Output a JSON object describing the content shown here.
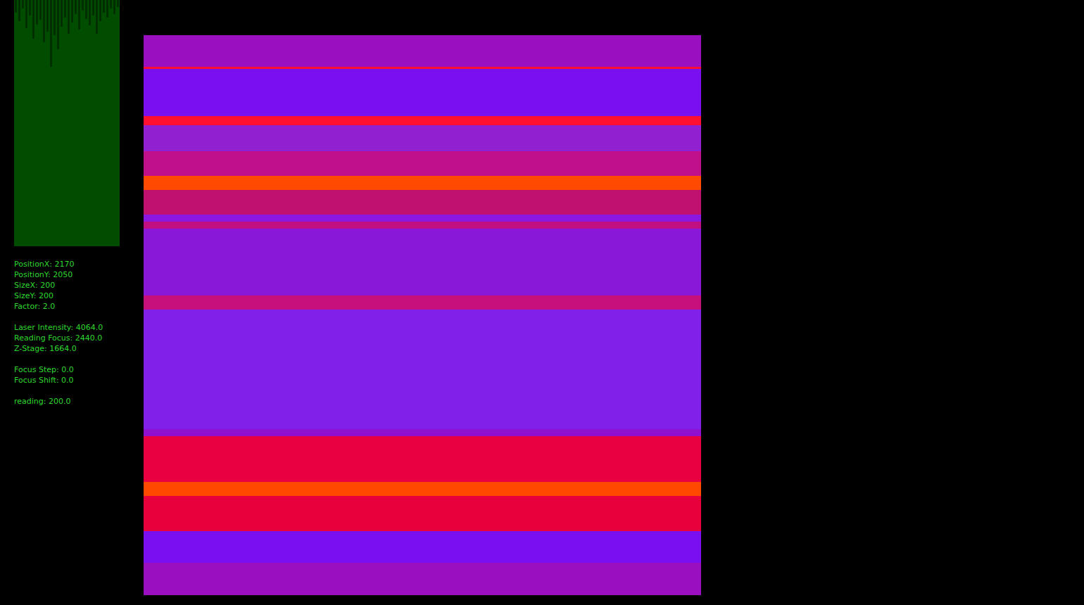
{
  "histogram": {
    "values": [
      18,
      30,
      12,
      40,
      22,
      55,
      35,
      28,
      60,
      45,
      95,
      50,
      70,
      38,
      25,
      48,
      32,
      20,
      42,
      15,
      27,
      36,
      22,
      48,
      30,
      18,
      25,
      12,
      20,
      10
    ]
  },
  "readouts": [
    [
      "PositionX: 2170",
      "PositionY: 2050",
      "SizeX: 200",
      "SizeY: 200",
      "Factor: 2.0"
    ],
    [
      "Laser Intensity: 4064.0",
      "Reading Focus: 2440.0",
      "Z-Stage: 1664.0"
    ],
    [
      "Focus Step: 0.0",
      "Focus Shift: 0.0"
    ],
    [
      "reading: 200.0"
    ]
  ]
}
